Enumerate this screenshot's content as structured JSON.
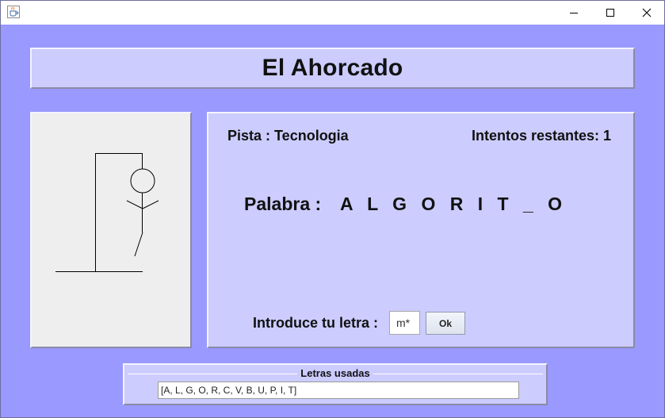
{
  "window": {
    "title": "",
    "app_icon": "java-cup-icon",
    "controls": {
      "minimize_icon": "minimize-icon",
      "maximize_icon": "maximize-icon",
      "close_icon": "close-icon"
    }
  },
  "header": {
    "title": "El Ahorcado"
  },
  "hangman": {
    "state_icon": "hangman-drawing-icon"
  },
  "info": {
    "pista": "Pista : Tecnologia",
    "intentos": "Intentos restantes: 1",
    "palabra_label": "Palabra :",
    "palabra_value": "A L G O R I T _ O",
    "letra_label": "Introduce tu letra :",
    "letra_value": "m*",
    "ok_label": "Ok"
  },
  "usadas": {
    "title": "Letras usadas",
    "value": "[A, L, G, O, R, C, V, B, U, P, I, T]"
  },
  "colors": {
    "background": "#9999ff",
    "panel": "#ccccff",
    "drawing_panel": "#eeeeee"
  }
}
